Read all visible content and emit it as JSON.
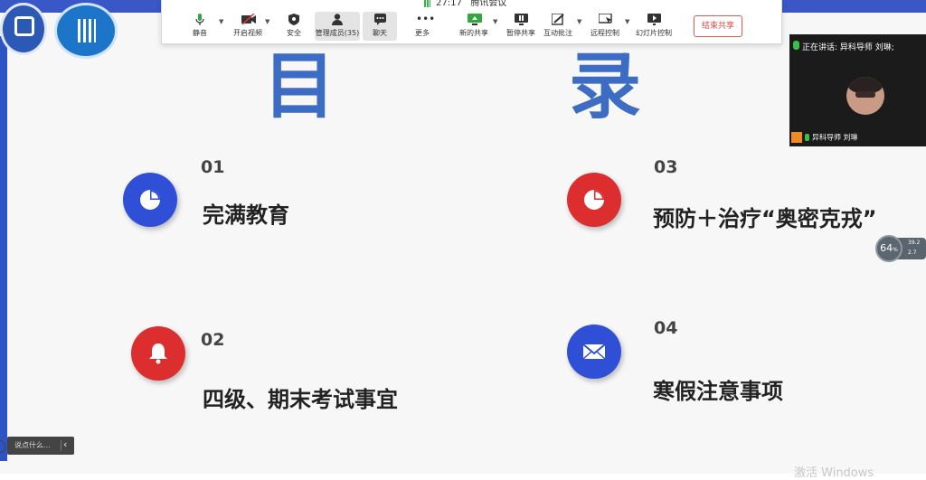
{
  "meeting": {
    "timer": "27:17",
    "app_name": "腾讯会议"
  },
  "toolbar": {
    "mute": "静音",
    "video": "开启视频",
    "security": "安全",
    "members": "管理成员(35)",
    "chat": "聊天",
    "more": "更多",
    "new_share": "新的共享",
    "pause_share": "暂停共享",
    "annotate": "互动批注",
    "remote_control": "远程控制",
    "slideshow": "幻灯片控制",
    "end_share": "结束共享"
  },
  "slide": {
    "heading_left": "目",
    "heading_right": "录",
    "items": [
      {
        "number": "01",
        "label": "完满教育",
        "color": "#2f4fd6",
        "icon": "pie-chart-icon"
      },
      {
        "number": "02",
        "label": "四级、期末考试事宜",
        "color": "#dc2e2e",
        "icon": "bell-icon"
      },
      {
        "number": "03",
        "label": "预防＋治疗“奥密克戎”",
        "color": "#dc2e2e",
        "icon": "pie-chart-icon"
      },
      {
        "number": "04",
        "label": "寒假注意事项",
        "color": "#2f4fd6",
        "icon": "mail-icon"
      }
    ]
  },
  "video_panel": {
    "speaking": "正在讲话: 异科导师 刘琳;",
    "participant_name": "异科导师 刘琳"
  },
  "network": {
    "percent": "64",
    "unit": "%",
    "up": "39.2",
    "down": "2.7"
  },
  "chat_input": {
    "placeholder": "说点什么..."
  },
  "watermark": "激活 Windows"
}
